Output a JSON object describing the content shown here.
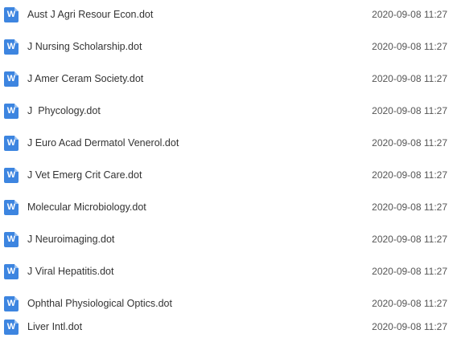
{
  "icon": {
    "name": "word-document-icon",
    "glyph": "W",
    "color": "#3d85e0"
  },
  "files": [
    {
      "name": "Aust J Agri Resour Econ.dot",
      "modified": "2020-09-08 11:27"
    },
    {
      "name": "J Nursing Scholarship.dot",
      "modified": "2020-09-08 11:27"
    },
    {
      "name": "J Amer Ceram Society.dot",
      "modified": "2020-09-08 11:27"
    },
    {
      "name": "J  Phycology.dot",
      "modified": "2020-09-08 11:27"
    },
    {
      "name": "J Euro Acad Dermatol Venerol.dot",
      "modified": "2020-09-08 11:27"
    },
    {
      "name": "J Vet Emerg Crit Care.dot",
      "modified": "2020-09-08 11:27"
    },
    {
      "name": "Molecular Microbiology.dot",
      "modified": "2020-09-08 11:27"
    },
    {
      "name": "J Neuroimaging.dot",
      "modified": "2020-09-08 11:27"
    },
    {
      "name": "J Viral Hepatitis.dot",
      "modified": "2020-09-08 11:27"
    },
    {
      "name": "Ophthal Physiological Optics.dot",
      "modified": "2020-09-08 11:27"
    },
    {
      "name": "Liver Intl.dot",
      "modified": "2020-09-08 11:27"
    }
  ]
}
